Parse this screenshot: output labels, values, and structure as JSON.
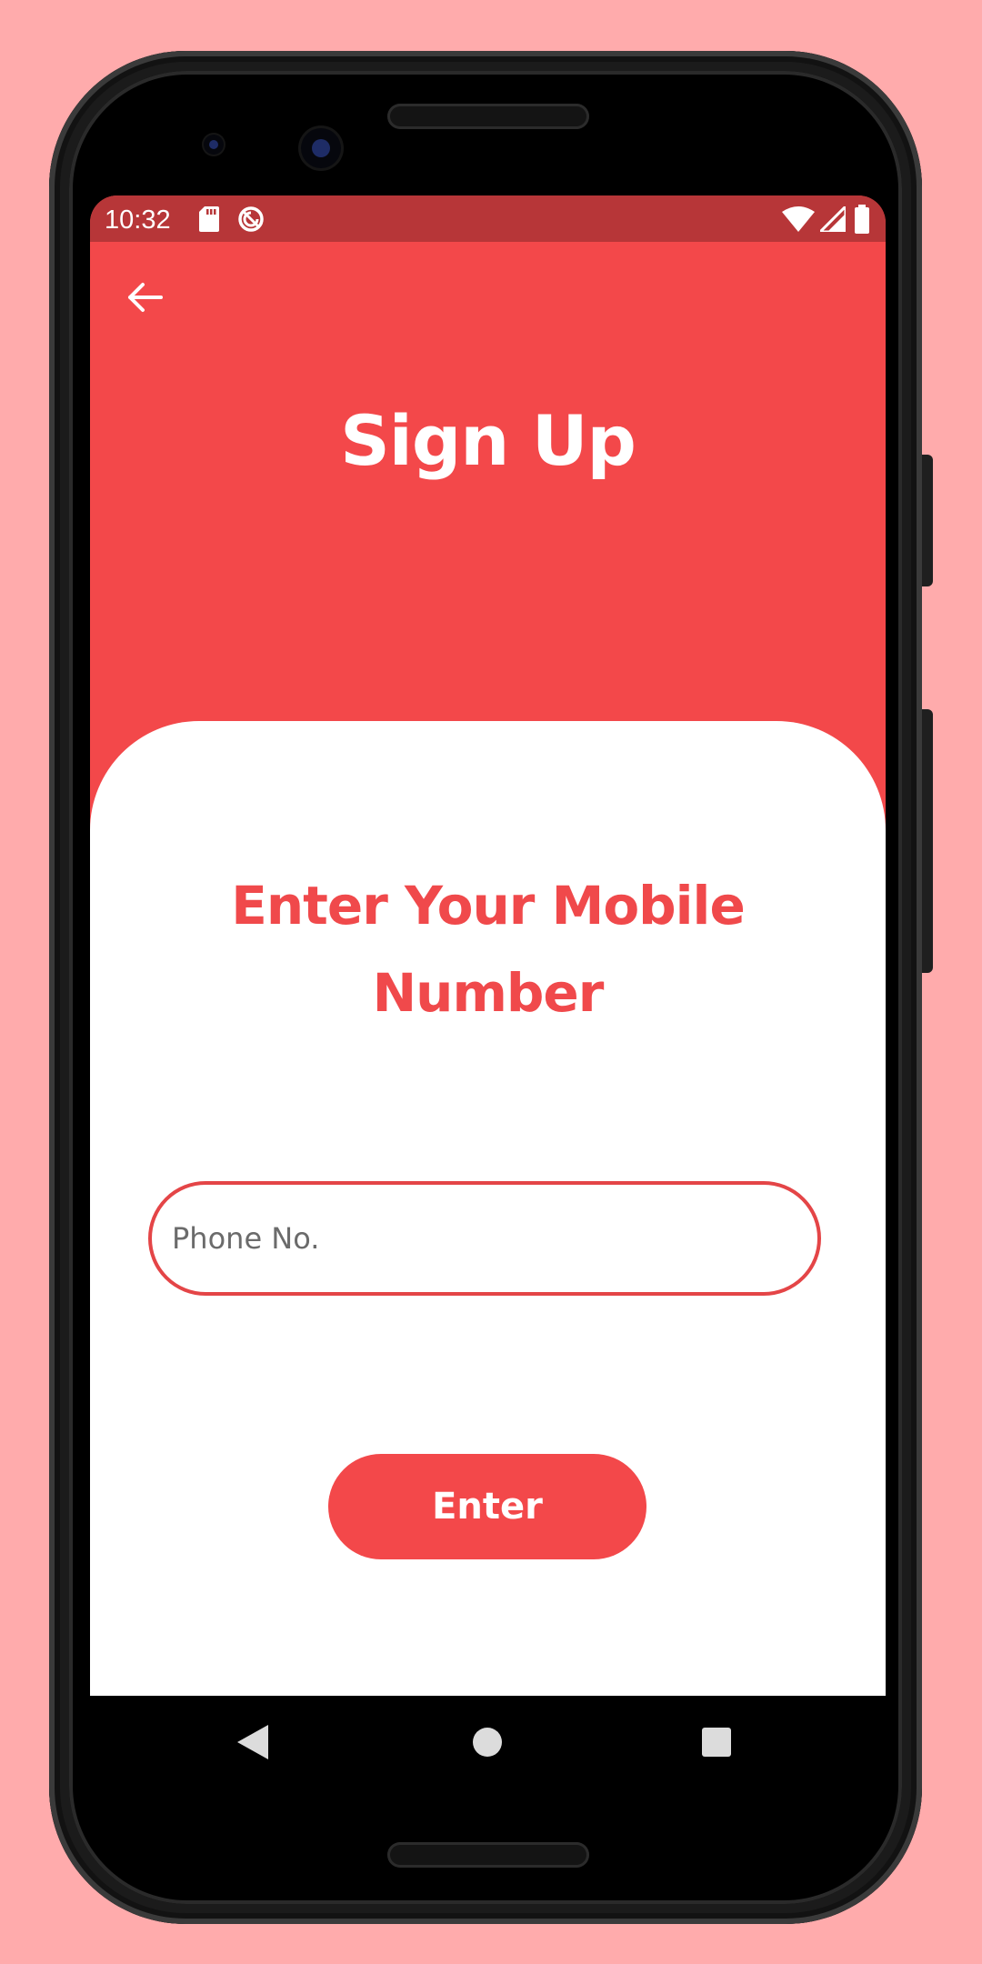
{
  "status_bar": {
    "time": "10:32",
    "icons": [
      "sd-card-icon",
      "sync-icon",
      "wifi-icon",
      "signal-icon",
      "battery-icon"
    ]
  },
  "header": {
    "back_icon": "arrow-left-icon",
    "title": "Sign Up"
  },
  "card": {
    "heading_line1": "Enter Your Mobile",
    "heading_line2": "Number",
    "phone_input": {
      "placeholder": "Phone No.",
      "value": ""
    },
    "enter_label": "Enter"
  },
  "nav_bar": {
    "icons": [
      "nav-back-icon",
      "nav-home-icon",
      "nav-recents-icon"
    ]
  },
  "colors": {
    "accent": "#f3484a",
    "status_bar": "#b73638",
    "page_background": "#ffabac"
  }
}
